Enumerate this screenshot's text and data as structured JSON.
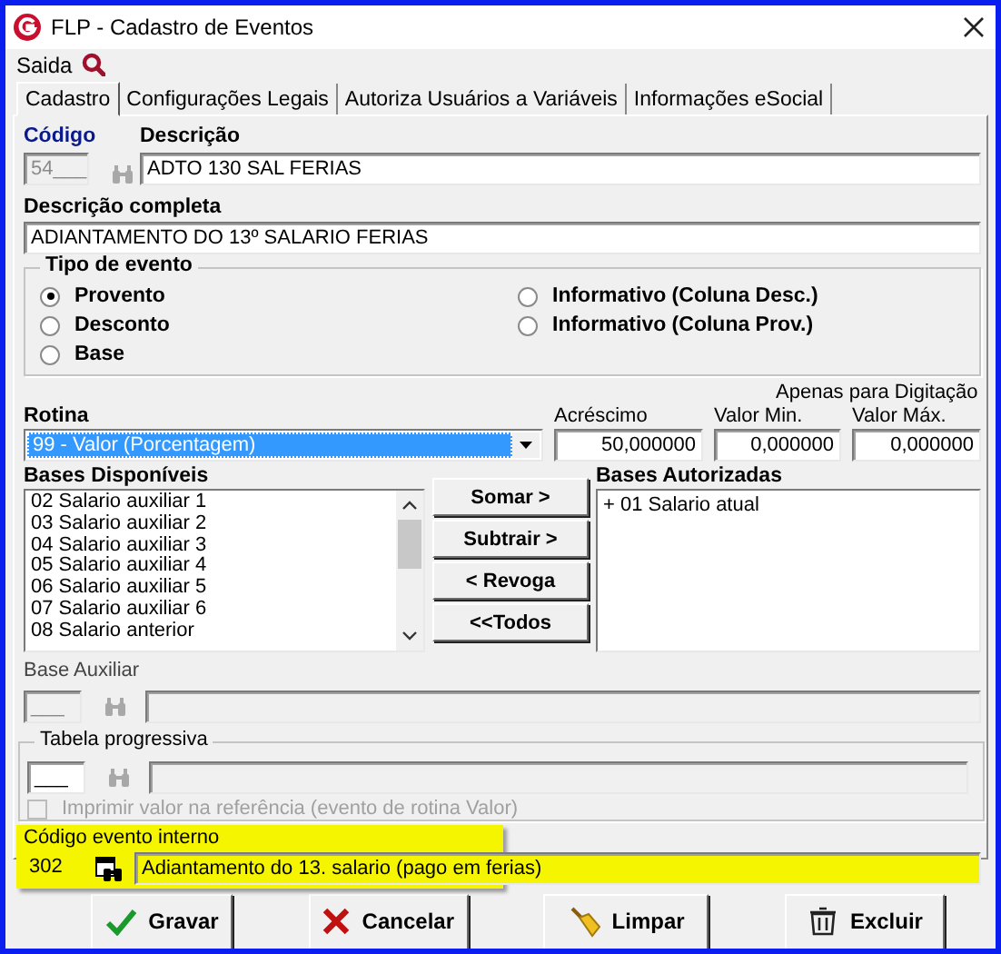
{
  "window": {
    "title": "FLP - Cadastro de Eventos"
  },
  "menu": [
    {
      "label": "Saida"
    }
  ],
  "tabs": [
    {
      "label": "Cadastro",
      "selected": true
    },
    {
      "label": "Configurações Legais",
      "selected": false
    },
    {
      "label": "Autoriza Usuários a Variáveis",
      "selected": false
    },
    {
      "label": "Informações eSocial",
      "selected": false
    }
  ],
  "codigo": {
    "label": "Código",
    "value": "54___",
    "disabled": true
  },
  "descricao": {
    "label": "Descrição",
    "value": "ADTO 130 SAL FERIAS"
  },
  "descricao_completa": {
    "label": "Descrição completa",
    "value": "ADIANTAMENTO DO 13º SALARIO FERIAS"
  },
  "tipo_de_evento": {
    "title": "Tipo de evento",
    "options": [
      {
        "label": "Provento",
        "selected": true
      },
      {
        "label": "Desconto",
        "selected": false
      },
      {
        "label": "Base",
        "selected": false
      },
      {
        "label": "Informativo (Coluna Desc.)",
        "selected": false
      },
      {
        "label": "Informativo (Coluna Prov.)",
        "selected": false
      }
    ]
  },
  "rotina": {
    "label": "Rotina",
    "value": "99 - Valor (Porcentagem)"
  },
  "digitacao_note": "Apenas para Digitação",
  "numeric_fields": [
    {
      "label": "Acréscimo",
      "value": "50,000000"
    },
    {
      "label": "Valor Min.",
      "value": "0,000000"
    },
    {
      "label": "Valor Máx.",
      "value": "0,000000"
    }
  ],
  "bases_disponiveis": {
    "label": "Bases Disponíveis",
    "items": [
      "02 Salario auxiliar 1",
      "03 Salario auxiliar 2",
      "04 Salario auxiliar 3",
      "05 Salario auxiliar 4",
      "06 Salario auxiliar 5",
      "07 Salario auxiliar 6",
      "08 Salario anterior"
    ]
  },
  "transfer_buttons": [
    {
      "label": "Somar >"
    },
    {
      "label": "Subtrair >"
    },
    {
      "label": "< Revoga"
    },
    {
      "label": "<<Todos"
    }
  ],
  "bases_autorizadas": {
    "label": "Bases Autorizadas",
    "items": [
      "+ 01 Salario atual"
    ]
  },
  "base_auxiliar": {
    "label": "Base Auxiliar",
    "value": "___",
    "disabled": true
  },
  "tabela_progressiva": {
    "title": "Tabela progressiva",
    "value": "___"
  },
  "imprimir": {
    "label": "Imprimir valor na referência (evento de rotina Valor)",
    "checked": false,
    "disabled": true
  },
  "codigo_evento_interno": {
    "label": "Código evento interno",
    "code": "302",
    "description": "Adiantamento do 13. salario (pago em ferias)",
    "highlighted": true
  },
  "actions": [
    {
      "label": "Gravar",
      "kind": "save"
    },
    {
      "label": "Cancelar",
      "kind": "cancel"
    },
    {
      "label": "Limpar",
      "kind": "clear"
    },
    {
      "label": "Excluir",
      "kind": "delete"
    }
  ]
}
